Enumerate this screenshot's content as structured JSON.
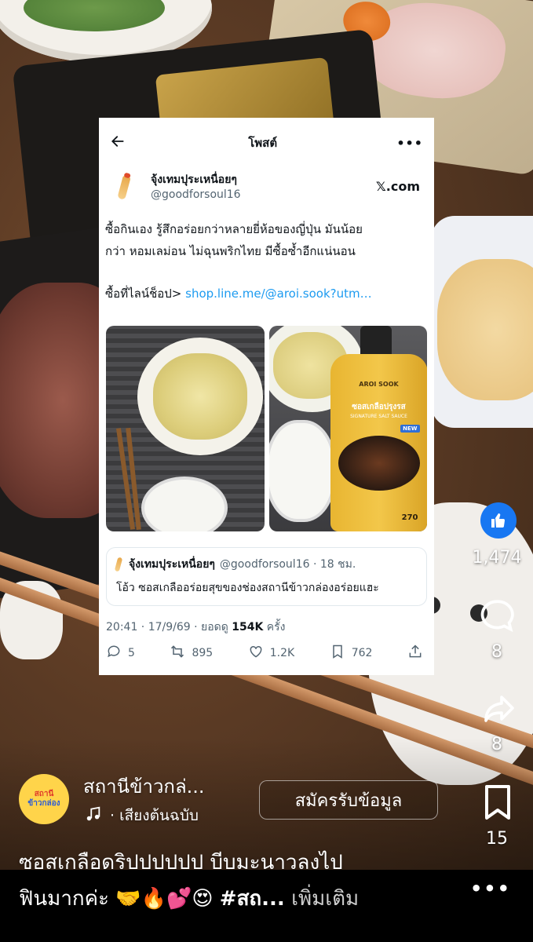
{
  "post": {
    "header_title": "โพสต์",
    "author_name": "จุ้งเทมปุระเหนื่อยๆ",
    "author_handle": "@goodforsoul16",
    "site_badge": "𝕏.com",
    "text_line1": "ซื้อกินเอง รู้สึกอร่อยกว่าหลายยี่ห้อของญี่ปุ่น มันน้อย",
    "text_line2": "กว่า หอมเลม่อน ไม่ฉุนพริกไทย มีซื้อซ้ำอีกแน่นอน",
    "shop_prefix": "ซื้อที่ไลน์ช็อป> ",
    "shop_link": "shop.line.me/@aroi.sook?utm…",
    "bottle_brand": "AROI SOOK",
    "bottle_label": "ซอสเกลือปรุงรส",
    "bottle_sub": "SIGNATURE SALT SAUCE",
    "bottle_new": "NEW",
    "bottle_volume": "270",
    "quote_name": "จุ้งเทมปุระเหนื่อยๆ",
    "quote_handle": "@goodforsoul16 · 18 ชม.",
    "quote_text": "โอ้ว ซอสเกลืออร่อยสุขของช่องสถานีข้าวกล่องอร่อยแฮะ",
    "meta_time": "20:41 · 17/9/69 · ยอดดู ",
    "meta_views": "154K",
    "meta_suffix": " ครั้ง",
    "replies": "5",
    "reposts": "895",
    "likes": "1.2K",
    "bookmarks": "762"
  },
  "rail": {
    "like_count": "1,474",
    "comment_count": "8",
    "share_count": "8",
    "save_count": "15"
  },
  "page": {
    "avatar_line1": "สถานี",
    "avatar_line2": "ข้าวกล่อง",
    "name": "สถานีข้าวกล่...",
    "audio": "· เสียงต้นฉบับ",
    "subscribe": "สมัครรับข้อมูล",
    "caption_line1": "ซอสเกลือดริปปปปปป  บีบมะนาวลงไป",
    "caption_line2_text": "ฟินมากค่ะ 🤝🔥💕😍 ",
    "caption_hashtag": "#สถ...",
    "caption_more": " เพิ่มเติม"
  },
  "colors": {
    "like_blue": "#1877f2",
    "link_blue": "#1d9bf0"
  },
  "icons": [
    "back-arrow-icon",
    "more-icon",
    "x-logo",
    "reply-icon",
    "repost-icon",
    "like-icon",
    "bookmark-icon",
    "share-icon",
    "thumbs-up-icon",
    "comment-icon",
    "share-arrow-icon",
    "save-icon",
    "music-note-icon",
    "more-dots-icon"
  ]
}
